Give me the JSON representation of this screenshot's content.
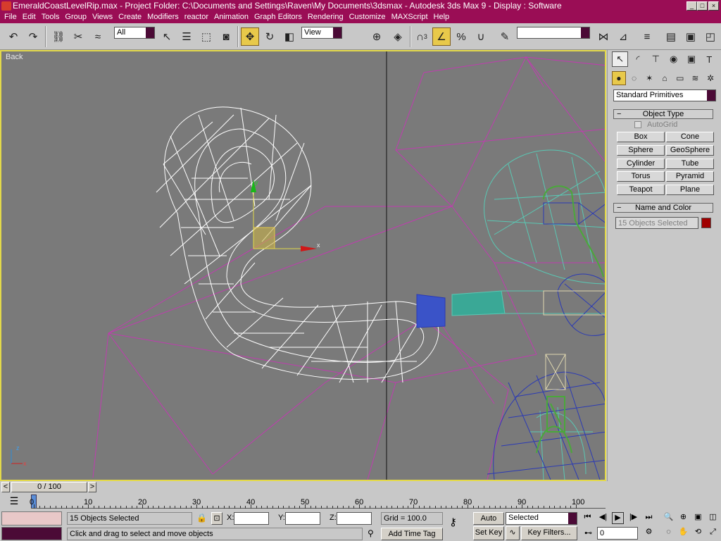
{
  "window": {
    "title": "EmeraldCoastLevelRip.max    - Project Folder: C:\\Documents and Settings\\Raven\\My Documents\\3dsmax    - Autodesk 3ds Max 9     - Display : Software",
    "min": "_",
    "max": "□",
    "close": "×"
  },
  "menu": [
    "File",
    "Edit",
    "Tools",
    "Group",
    "Views",
    "Create",
    "Modifiers",
    "reactor",
    "Animation",
    "Graph Editors",
    "Rendering",
    "Customize",
    "MAXScript",
    "Help"
  ],
  "toolbar": {
    "selection_filter": "All",
    "ref_coord": "View",
    "named_selection": "",
    "angle_snap_label": "3"
  },
  "viewport": {
    "label": "Back",
    "gizmo_x": "x",
    "gizmo_y": "y",
    "axis_z": "z",
    "axis_x": "x"
  },
  "command_panel": {
    "category_dropdown": "Standard Primitives",
    "object_type_title": "Object Type",
    "autogrid": "AutoGrid",
    "buttons": [
      "Box",
      "Cone",
      "Sphere",
      "GeoSphere",
      "Cylinder",
      "Tube",
      "Torus",
      "Pyramid",
      "Teapot",
      "Plane"
    ],
    "name_color_title": "Name and Color",
    "name_field": "15 Objects Selected",
    "object_color": "#a00000"
  },
  "timeslider": {
    "frame": "0 / 100",
    "prev": "<",
    "next": ">"
  },
  "trackbar": {
    "ticks": [
      "0",
      "10",
      "20",
      "30",
      "40",
      "50",
      "60",
      "70",
      "80",
      "90",
      "100"
    ]
  },
  "status": {
    "selection": "15 Objects Selected",
    "prompt": "Click and drag to select and move objects",
    "x_label": "X:",
    "y_label": "Y:",
    "z_label": "Z:",
    "x": "",
    "y": "",
    "z": "",
    "grid": "Grid = 100.0",
    "add_time_tag": "Add Time Tag",
    "auto_key": "Auto Key",
    "set_key": "Set Key",
    "key_mode": "Selected",
    "key_filters": "Key Filters...",
    "current_frame": "0"
  }
}
